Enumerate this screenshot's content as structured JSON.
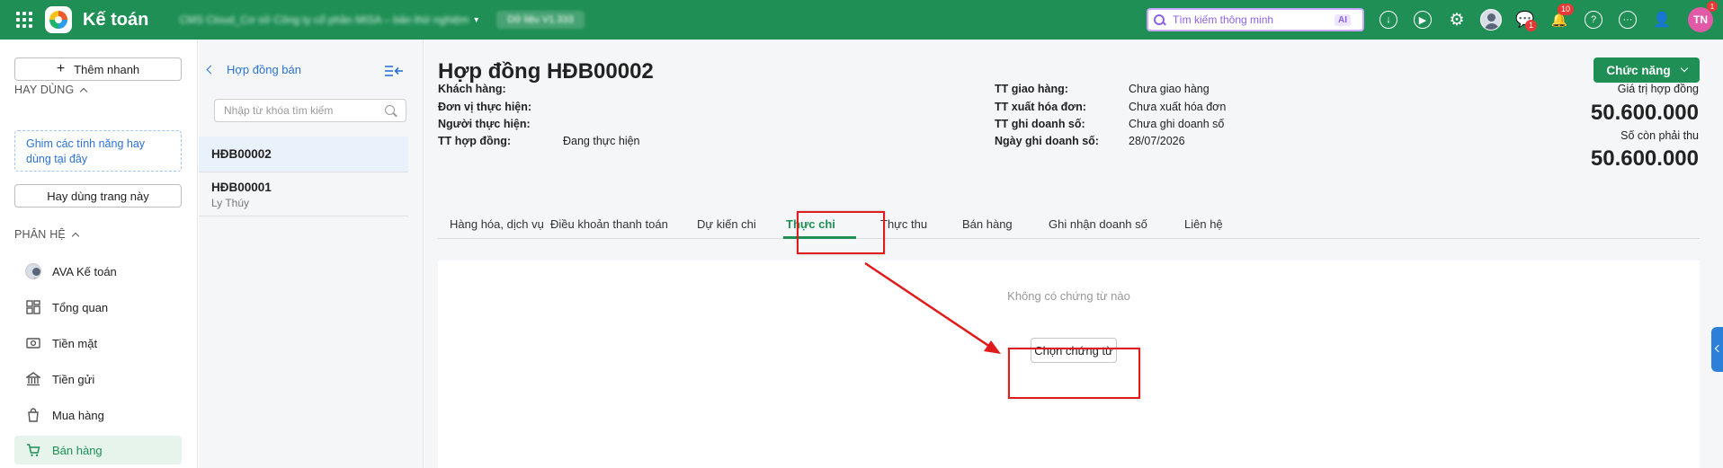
{
  "topbar": {
    "app_title": "Kế toán",
    "company": "CMS Cloud_Cơ sở Công ty cổ phần MISA – bản thử nghiệm",
    "db_label": "Dữ liệu V1.333",
    "search_placeholder": "Tìm kiếm thông minh",
    "ai_label": "AI",
    "chat_badge": "1",
    "notif_badge": "10",
    "user_initials": "TN",
    "user_badge": "1",
    "accent_color": "#1f8f55"
  },
  "sidebar": {
    "quick_add": "Thêm nhanh",
    "frequent_title": "HAY DÙNG",
    "pin_hint": "Ghim các tính năng hay dùng tại đây",
    "frequent_button": "Hay dùng trang này",
    "modules_title": "PHÂN HỆ",
    "items": [
      {
        "label": "AVA Kế toán",
        "icon": "ava-avatar-icon"
      },
      {
        "label": "Tổng quan",
        "icon": "dashboard-icon"
      },
      {
        "label": "Tiền mặt",
        "icon": "cash-icon"
      },
      {
        "label": "Tiền gửi",
        "icon": "bank-icon"
      },
      {
        "label": "Mua hàng",
        "icon": "shopping-bag-icon"
      },
      {
        "label": "Bán hàng",
        "icon": "cart-icon",
        "active": true
      }
    ]
  },
  "list": {
    "back_label": "Hợp đồng bán",
    "search_placeholder": "Nhập từ khóa tìm kiếm",
    "rows": [
      {
        "code": "HĐB00002",
        "sub": ""
      },
      {
        "code": "HĐB00001",
        "sub": "Ly Thúy"
      }
    ]
  },
  "main": {
    "title": "Hợp đồng HĐB00002",
    "function_button": "Chức năng",
    "info_left": [
      {
        "label": "Khách hàng:",
        "value": ""
      },
      {
        "label": "Đơn vị thực hiện:",
        "value": ""
      },
      {
        "label": "Người thực hiện:",
        "value": ""
      },
      {
        "label": "TT hợp đồng:",
        "value": "Đang thực hiện"
      }
    ],
    "info_right": [
      {
        "label": "TT giao hàng:",
        "value": "Chưa giao hàng"
      },
      {
        "label": "TT xuất hóa đơn:",
        "value": "Chưa xuất hóa đơn"
      },
      {
        "label": "TT ghi doanh số:",
        "value": "Chưa ghi doanh số"
      },
      {
        "label": "Ngày ghi doanh số:",
        "value": "28/07/2026"
      }
    ],
    "contract_value_label": "Giá trị hợp đồng",
    "contract_value": "50.600.000",
    "remaining_label": "Số còn phải thu",
    "remaining_value": "50.600.000",
    "tabs": [
      "Hàng hóa, dịch vụ",
      "Điều khoản thanh toán",
      "Dự kiến chi",
      "Thực chi",
      "Thực thu",
      "Bán hàng",
      "Ghi nhận doanh số",
      "Liên hệ"
    ],
    "active_tab": "Thực chi",
    "empty_text": "Không có chứng từ nào",
    "choose_button": "Chọn chứng từ"
  }
}
